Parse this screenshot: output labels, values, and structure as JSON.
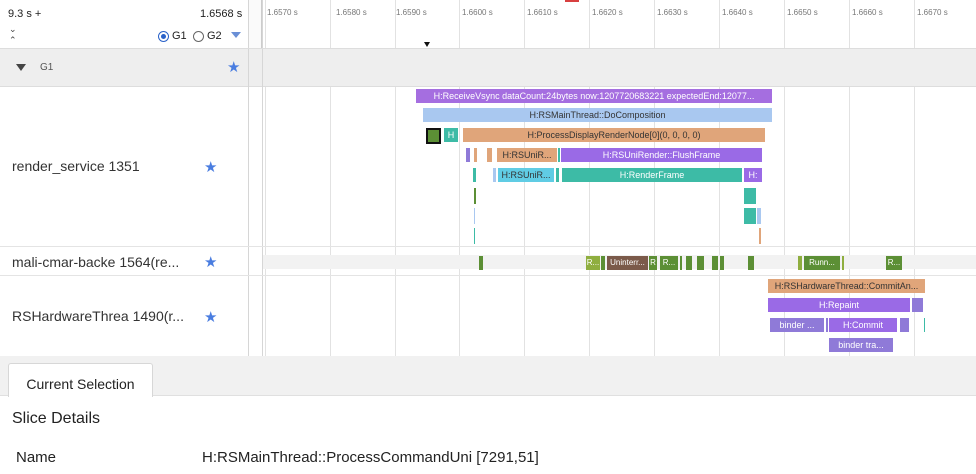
{
  "header": {
    "range_start": "9.3 s +",
    "range_end": "1.6568 s",
    "group_options": [
      {
        "label": "G1",
        "selected": true
      },
      {
        "label": "G2",
        "selected": false
      }
    ]
  },
  "timeline": {
    "ticks": [
      "1.6570 s",
      "1.6580 s",
      "1.6590 s",
      "1.6600 s",
      "1.6610 s",
      "1.6620 s",
      "1.6630 s",
      "1.6640 s",
      "1.6650 s",
      "1.6660 s",
      "1.6670 s"
    ]
  },
  "group": {
    "label": "G1"
  },
  "rows": [
    {
      "label": "render_service 1351"
    },
    {
      "label": "mali-cmar-backe 1564(re..."
    },
    {
      "label": "RSHardwareThrea 1490(r..."
    }
  ],
  "slices": {
    "receive_vsync": "H:ReceiveVsync dataCount:24bytes now:1207720683221 expectedEnd:12077...",
    "do_composition": "H:RSMainThread::DoComposition",
    "process_display": "H:ProcessDisplayRenderNode[0](0, 0, 0, 0)",
    "h_small": "H",
    "rsuni_1": "H:RSUniR...",
    "flush_frame": "H:RSUniRender::FlushFrame",
    "rsuni_2": "H:RSUniR...",
    "render_frame": "H:RenderFrame",
    "h_small2": "H:",
    "mali_r1": "R...",
    "mali_uninterr": "Uninterr...",
    "mali_r2": "R",
    "mali_r3": "R...",
    "mali_runn": "Runn...",
    "mali_r4": "R...",
    "commit_an": "H:RSHardwareThread::CommitAn...",
    "repaint": "H:Repaint",
    "binder1": "binder ...",
    "commit": "H:Commit",
    "binder_tra": "binder tra..."
  },
  "bottom": {
    "tab_label": "Current Selection",
    "section_title": "Slice Details",
    "name_key": "Name",
    "name_value": "H:RSMainThread::ProcessCommandUni [7291,51]"
  },
  "colors": {
    "purple": "#a56ee0",
    "light_blue": "#a9c8f0",
    "orange": "#e0a57a",
    "teal": "#3dbba6",
    "violet": "#9a6ae6",
    "cyan": "#60cce4",
    "green": "#5c8f35",
    "olive": "#8fae3f",
    "brown": "#7b5a4a",
    "lavender": "#8f7ad8"
  }
}
